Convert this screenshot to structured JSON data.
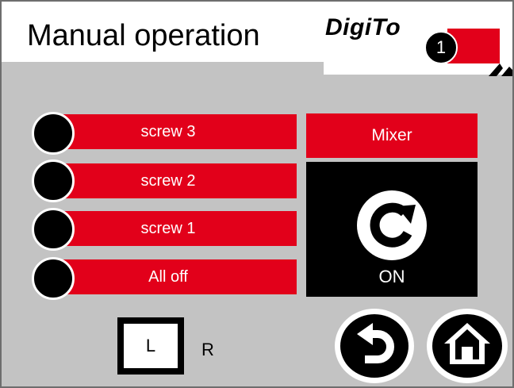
{
  "header": {
    "title": "Manual operation",
    "logo_text": "DigiTo",
    "badge": "1"
  },
  "screws": [
    {
      "label": "screw 3",
      "lamp_state": "off"
    },
    {
      "label": "screw 2",
      "lamp_state": "off"
    },
    {
      "label": "screw 1",
      "lamp_state": "off"
    },
    {
      "label": "All off",
      "lamp_state": "off"
    }
  ],
  "mixer": {
    "label": "Mixer",
    "state": "ON",
    "icon": "rotate-icon"
  },
  "side_selector": {
    "left_label": "L",
    "right_label": "R",
    "selected": "L"
  },
  "nav": {
    "back_icon": "back-arrow-icon",
    "home_icon": "home-icon"
  },
  "colors": {
    "accent_red": "#e2001a",
    "background": "#c3c3c3",
    "lamp_off": "#000000"
  }
}
